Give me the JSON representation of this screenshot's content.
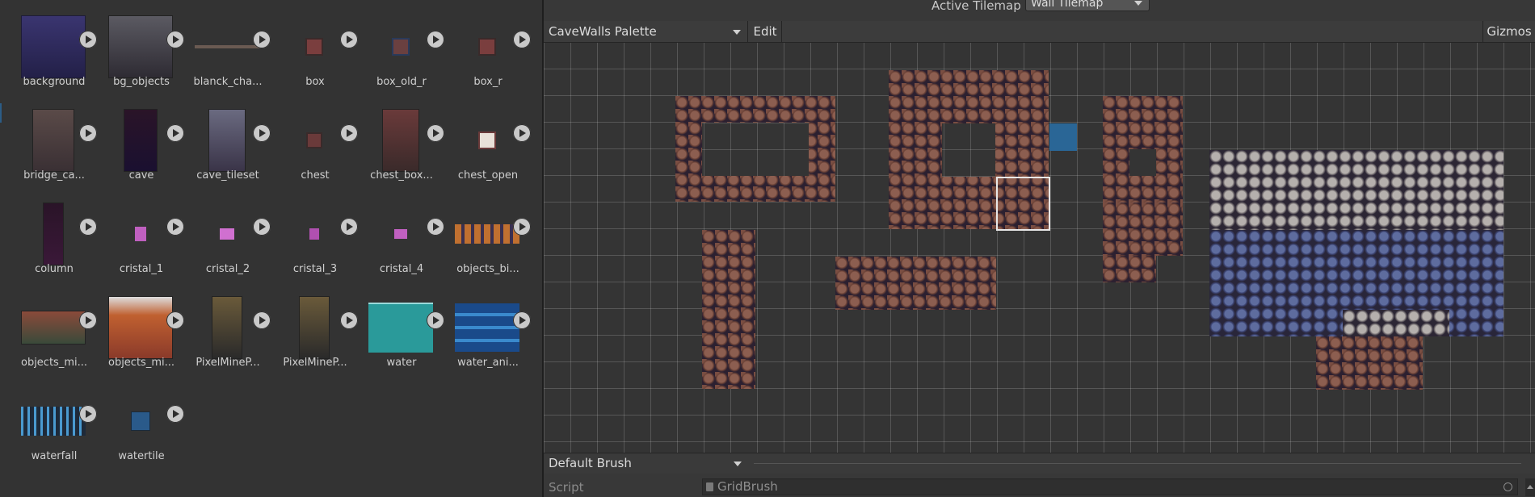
{
  "assets": [
    {
      "label": "background"
    },
    {
      "label": "bg_objects"
    },
    {
      "label": "blanck_cha..."
    },
    {
      "label": "box"
    },
    {
      "label": "box_old_r"
    },
    {
      "label": "box_r"
    },
    {
      "label": "bridge_ca..."
    },
    {
      "label": "cave"
    },
    {
      "label": "cave_tileset"
    },
    {
      "label": "chest"
    },
    {
      "label": "chest_box..."
    },
    {
      "label": "chest_open"
    },
    {
      "label": "column"
    },
    {
      "label": "cristal_1"
    },
    {
      "label": "cristal_2"
    },
    {
      "label": "cristal_3"
    },
    {
      "label": "cristal_4"
    },
    {
      "label": "objects_bi..."
    },
    {
      "label": "objects_mi..."
    },
    {
      "label": "objects_mi..."
    },
    {
      "label": "PixelMineP..."
    },
    {
      "label": "PixelMineP..."
    },
    {
      "label": "water"
    },
    {
      "label": "water_ani..."
    },
    {
      "label": "waterfall"
    },
    {
      "label": "watertile"
    }
  ],
  "palette": {
    "active_tilemap_label": "Active Tilemap",
    "active_tilemap_value": "Wall Tilemap",
    "palette_name": "CaveWalls Palette",
    "edit_label": "Edit",
    "gizmos_label": "Gizmos",
    "brush_name": "Default Brush",
    "script_label": "Script",
    "script_value": "GridBrush"
  },
  "colors": {
    "selection_accent": "#2a6696",
    "rock_brown": "#8c5e50",
    "rock_grey": "#b5b0ad",
    "rock_blue": "#5e6c9e",
    "water": "#2a9a9a"
  },
  "icons": {
    "play": "play-icon",
    "dropdown": "chevron-down-icon",
    "script": "script-file-icon",
    "target": "object-picker-icon"
  }
}
